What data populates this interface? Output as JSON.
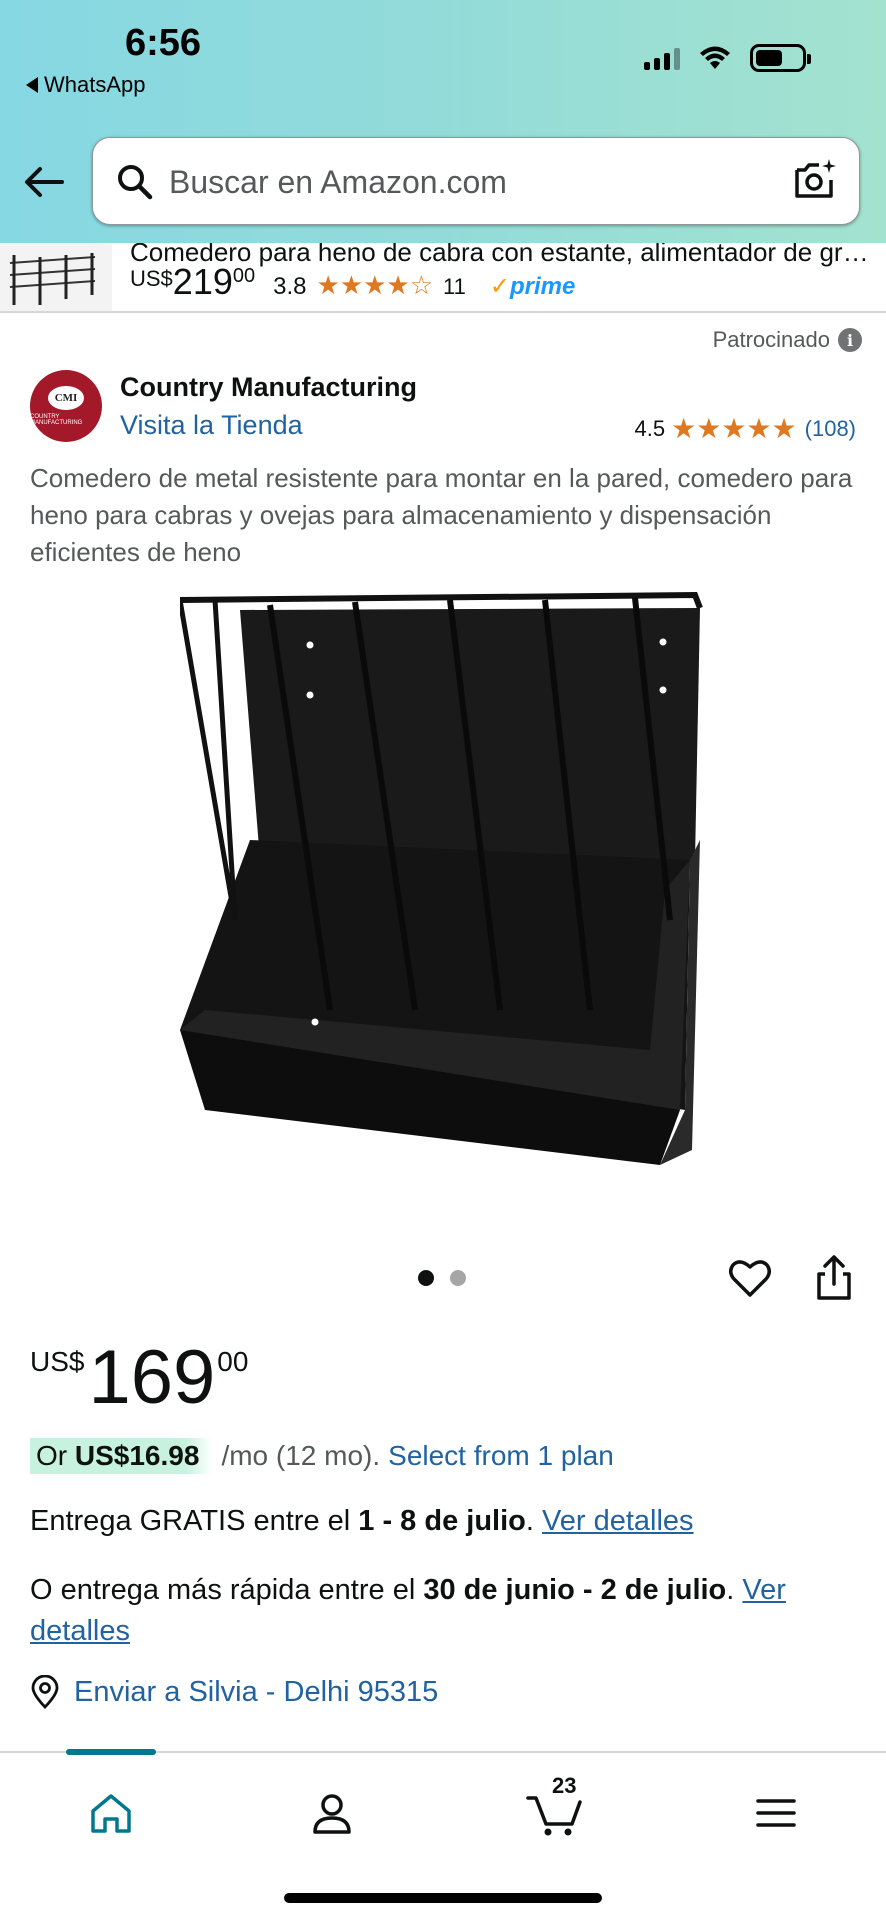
{
  "status_bar": {
    "time": "6:56",
    "back_app": "WhatsApp"
  },
  "search": {
    "placeholder": "Buscar en Amazon.com"
  },
  "prev_product": {
    "title": "Comedero para heno de cabra con estante, alimentador de gran...",
    "currency": "US$",
    "price_whole": "219",
    "price_fraction": "00",
    "rating": "3.8",
    "stars": "★★★★☆",
    "review_count": "11",
    "prime_label": "prime"
  },
  "sponsored": {
    "label": "Patrocinado",
    "info_glyph": "i"
  },
  "brand": {
    "name": "Country Manufacturing",
    "store_link": "Visita la Tienda",
    "rating": "4.5",
    "stars": "★★★★★",
    "review_count": "(108)",
    "logo_text": "CMI",
    "logo_subtext": "COUNTRY MANUFACTURING"
  },
  "product": {
    "description": "Comedero de metal resistente para montar en la pared, comedero para heno para cabras y ovejas para almacenamiento y dispensación eficientes de heno",
    "image_count": 2,
    "active_image": 1,
    "currency": "US$",
    "price_whole": "169",
    "price_fraction": "00"
  },
  "installment": {
    "or_label": "Or",
    "amount": "US$16.98",
    "terms": "/mo (12 mo).",
    "link": "Select from 1 plan"
  },
  "delivery": {
    "free_prefix": "Entrega GRATIS entre el",
    "free_dates": "1 - 8 de julio",
    "free_link": "Ver detalles",
    "fast_prefix": "O entrega más rápida entre el",
    "fast_dates": "30 de junio - 2 de julio",
    "fast_link": "Ver detalles",
    "ship_to": "Enviar a Silvia - Delhi 95315"
  },
  "bottom_nav": {
    "items": [
      {
        "name": "home",
        "icon": "home-icon",
        "active": true
      },
      {
        "name": "account",
        "icon": "person-icon"
      },
      {
        "name": "cart",
        "icon": "cart-icon",
        "count": "23"
      },
      {
        "name": "menu",
        "icon": "hamburger-icon"
      }
    ]
  },
  "colors": {
    "link": "#2162a1",
    "star": "#de7921",
    "accent_teal": "#00798f",
    "badge_green": "#c8f2e0"
  }
}
